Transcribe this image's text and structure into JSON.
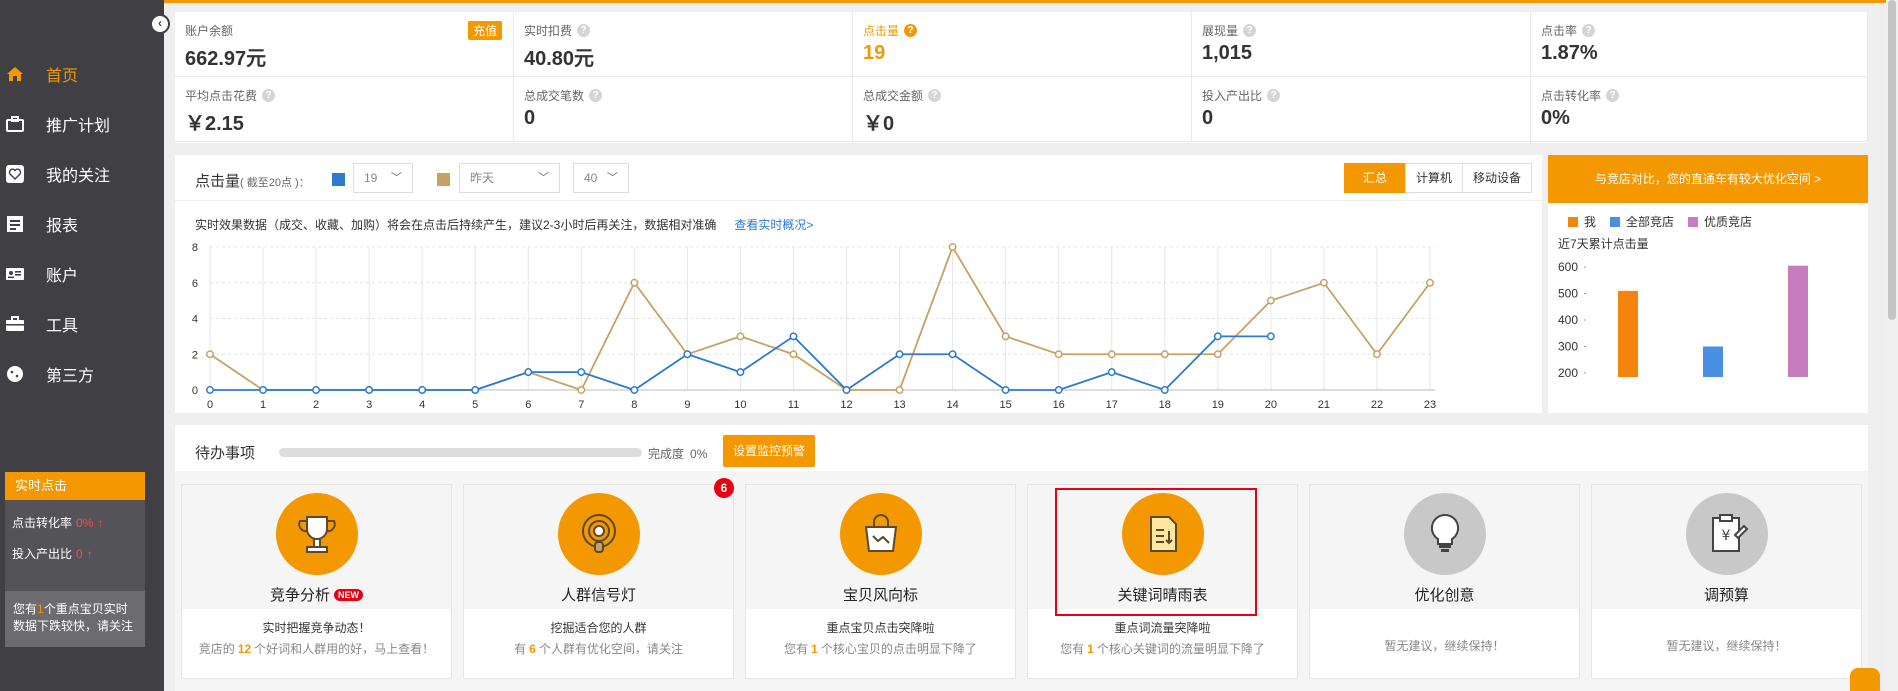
{
  "sidebar": {
    "items": [
      {
        "label": "首页",
        "icon": "home-icon",
        "active": true
      },
      {
        "label": "推广计划",
        "icon": "briefcase-icon"
      },
      {
        "label": "我的关注",
        "icon": "heart-icon"
      },
      {
        "label": "报表",
        "icon": "report-icon"
      },
      {
        "label": "账户",
        "icon": "id-card-icon"
      },
      {
        "label": "工具",
        "icon": "toolbox-icon"
      },
      {
        "label": "第三方",
        "icon": "cookie-icon"
      }
    ],
    "realtime": {
      "title": "实时点击",
      "ctr_label": "点击转化率",
      "ctr_value": "0%",
      "roi_label": "投入产出比",
      "roi_value": "0",
      "note_prefix": "您有",
      "note_count": "1",
      "note_suffix": "个重点宝贝实时数据下跌较快，请关注"
    }
  },
  "stats": {
    "recharge": "充值",
    "row1": [
      {
        "label": "账户余额",
        "value": "662.97元"
      },
      {
        "label": "实时扣费",
        "value": "40.80元"
      },
      {
        "label": "点击量",
        "value": "19"
      },
      {
        "label": "展现量",
        "value": "1,015"
      },
      {
        "label": "点击率",
        "value": "1.87%"
      }
    ],
    "row2": [
      {
        "label": "平均点击花费",
        "value": "￥2.15"
      },
      {
        "label": "总成交笔数",
        "value": "0"
      },
      {
        "label": "总成交金额",
        "value": "￥0"
      },
      {
        "label": "投入产出比",
        "value": "0"
      },
      {
        "label": "点击转化率",
        "value": "0%"
      }
    ]
  },
  "chart": {
    "title": "点击量",
    "title_note": "( 截至20点 )：",
    "select1_value": "19",
    "select2_value": "昨天",
    "select3_value": "40",
    "color_today": "#2a7ad2",
    "color_yesterday": "#c9a063",
    "tabs": [
      "汇总",
      "计算机",
      "移动设备"
    ],
    "note": "实时效果数据（成交、收藏、加购）将会在点击后持续产生，建议2-3小时后再关注，数据相对准确",
    "note_link": "查看实时概况>"
  },
  "chart_data": {
    "type": "line",
    "x": [
      0,
      1,
      2,
      3,
      4,
      5,
      6,
      7,
      8,
      9,
      10,
      11,
      12,
      13,
      14,
      15,
      16,
      17,
      18,
      19,
      20,
      21,
      22,
      23
    ],
    "ylim": [
      0,
      8
    ],
    "yticks": [
      0,
      2,
      4,
      6,
      8
    ],
    "series": [
      {
        "color": "#2a7ad2",
        "values": [
          0,
          0,
          0,
          0,
          0,
          0,
          1,
          1,
          0,
          2,
          1,
          3,
          0,
          2,
          2,
          0,
          0,
          1,
          0,
          3,
          3,
          null,
          null,
          null
        ]
      },
      {
        "color": "#c9a063",
        "values": [
          2,
          0,
          0,
          0,
          0,
          0,
          1,
          0,
          6,
          2,
          3,
          2,
          0,
          0,
          8,
          3,
          2,
          2,
          2,
          2,
          5,
          6,
          2,
          6
        ]
      }
    ]
  },
  "compare": {
    "banner": "与竞店对比，您的直通车有较大优化空间 >",
    "legend": [
      {
        "label": "我",
        "color": "#f5840c"
      },
      {
        "label": "全部竞店",
        "color": "#4a90e2"
      },
      {
        "label": "优质竞店",
        "color": "#c57dbd"
      }
    ],
    "subtitle": "近7天累计点击量",
    "yticks": [
      600,
      500,
      400,
      300,
      200
    ],
    "ylim": [
      200,
      600
    ],
    "values": [
      510,
      300,
      605
    ]
  },
  "todo": {
    "title": "待办事项",
    "progress_label": "完成度",
    "progress_value": "0%",
    "progress_fraction": 0,
    "monitor_button": "设置监控预警",
    "badge": "6",
    "cards": [
      {
        "name": "竞争分析",
        "new": "NEW",
        "line1": "实时把握竞争动态！",
        "line2_a": "竞店的",
        "line2_num": "12",
        "line2_b": "个好词和人群用的好，马上查看！"
      },
      {
        "name": "人群信号灯",
        "line1": "挖掘适合您的人群",
        "line2_a": "有",
        "line2_num": "6",
        "line2_b": "个人群有优化空间，请关注"
      },
      {
        "name": "宝贝风向标",
        "line1": "重点宝贝点击突降啦",
        "line2_a": "您有",
        "line2_num": "1",
        "line2_b": "个核心宝贝的点击明显下降了"
      },
      {
        "name": "关键词晴雨表",
        "line1": "重点词流量突降啦",
        "line2_a": "您有",
        "line2_num": "1",
        "line2_b": "个核心关键词的流量明显下降了"
      },
      {
        "name": "优化创意",
        "single": "暂无建议，继续保持！"
      },
      {
        "name": "调预算",
        "single": "暂无建议，继续保持！"
      }
    ]
  }
}
